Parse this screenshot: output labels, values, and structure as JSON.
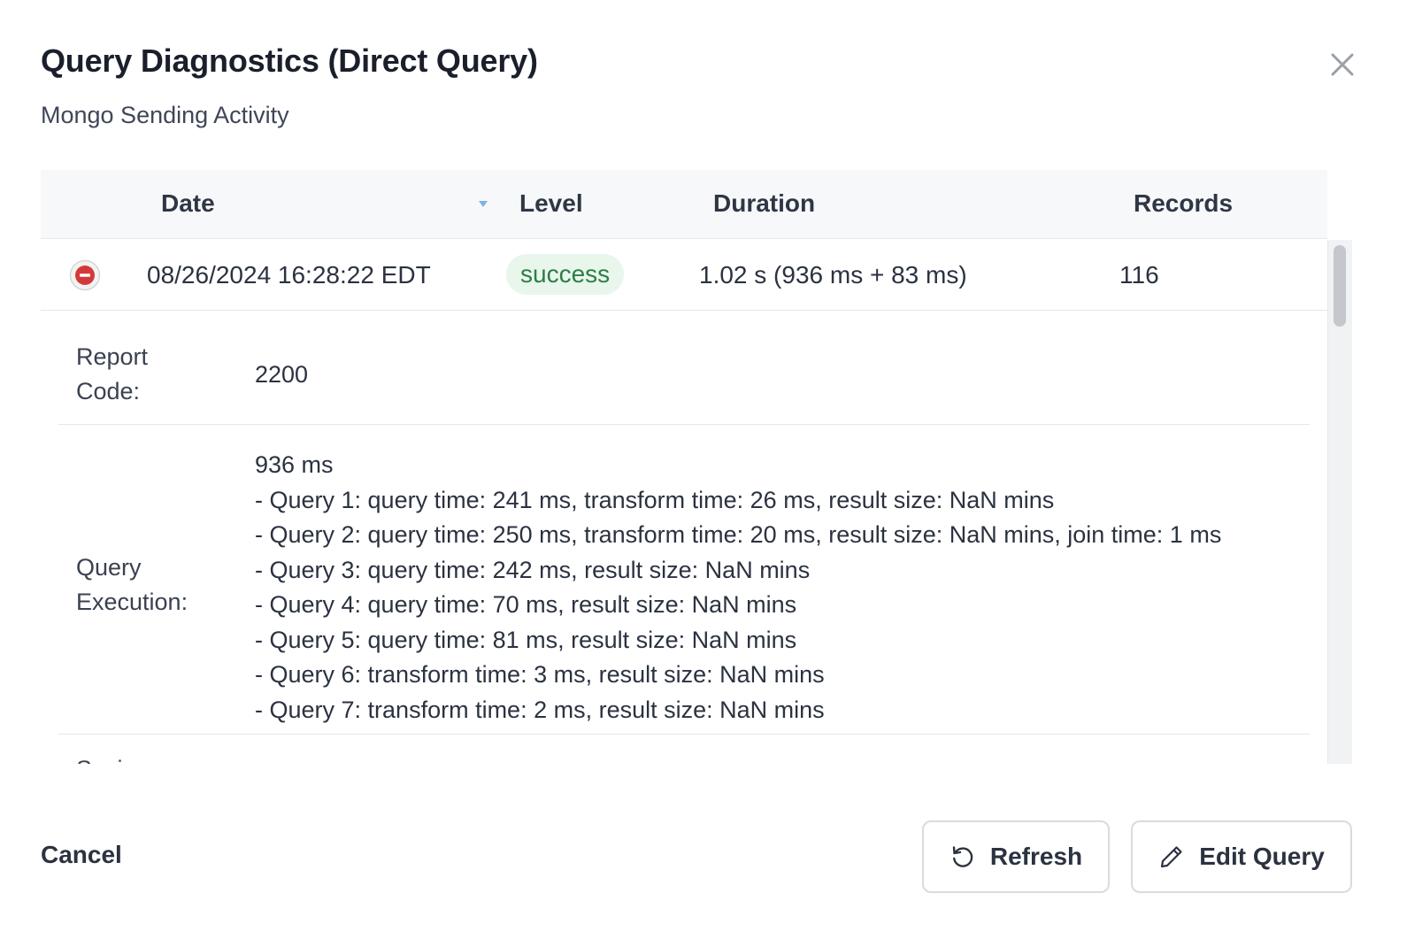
{
  "dialog": {
    "title": "Query Diagnostics (Direct Query)",
    "subtitle": "Mongo Sending Activity"
  },
  "table": {
    "columns": {
      "date": "Date",
      "level": "Level",
      "duration": "Duration",
      "records": "Records"
    },
    "row": {
      "date": "08/26/2024 16:28:22 EDT",
      "level": "success",
      "duration": "1.02 s (936 ms + 83 ms)",
      "records": "116"
    },
    "details": {
      "report_code_label_1": "Report",
      "report_code_label_2": "Code:",
      "report_code_value": "2200",
      "query_execution_label_1": "Query",
      "query_execution_label_2": "Execution:",
      "query_execution_lines": [
        "936 ms",
        "- Query 1: query time: 241 ms, transform time: 26 ms, result size: NaN mins",
        "- Query 2: query time: 250 ms, transform time: 20 ms, result size: NaN mins, join time: 1 ms",
        "- Query 3: query time: 242 ms, result size: NaN mins",
        "- Query 4: query time: 70 ms, result size: NaN mins",
        "- Query 5: query time: 81 ms, result size: NaN mins",
        "- Query 6: transform time: 3 ms, result size: NaN mins",
        "- Query 7: transform time: 2 ms, result size: NaN mins"
      ],
      "saving_label": "Saving"
    }
  },
  "footer": {
    "cancel_label": "Cancel",
    "refresh_label": "Refresh",
    "edit_query_label": "Edit Query"
  },
  "icons": {
    "close": "close-icon",
    "sort": "sort-desc-icon",
    "collapse": "minus-circle-icon",
    "refresh": "refresh-icon",
    "edit": "pencil-icon"
  },
  "colors": {
    "success_bg": "#e8f6ec",
    "success_text": "#2f7d46",
    "collapse_red": "#d23a3a"
  }
}
